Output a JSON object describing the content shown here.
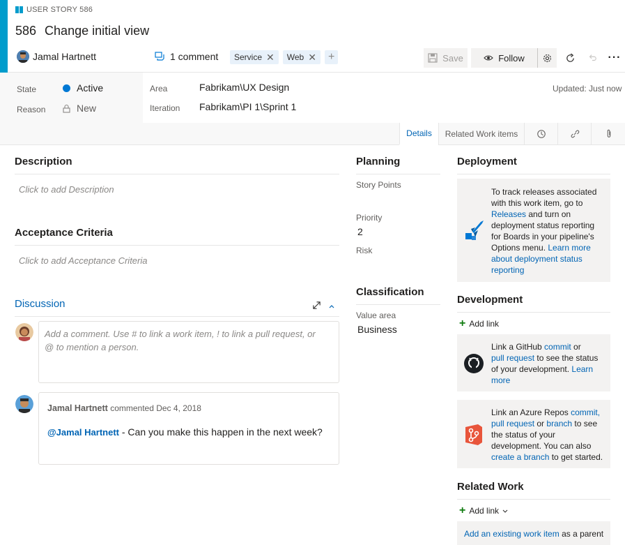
{
  "header": {
    "type_label": "USER STORY 586",
    "id": "586",
    "title": "Change initial view",
    "assignee": "Jamal Hartnett",
    "comments": "1 comment",
    "tags": [
      "Service",
      "Web"
    ],
    "save_label": "Save",
    "follow_label": "Follow",
    "accent_color": "#009ccc"
  },
  "fields": {
    "state_label": "State",
    "state_value": "Active",
    "state_color": "#0078d4",
    "reason_label": "Reason",
    "reason_value": "New",
    "area_label": "Area",
    "area_value": "Fabrikam\\UX Design",
    "iteration_label": "Iteration",
    "iteration_value": "Fabrikam\\PI 1\\Sprint 1",
    "updated": "Updated: Just now"
  },
  "tabs": {
    "details": "Details",
    "related": "Related Work items"
  },
  "description": {
    "title": "Description",
    "placeholder": "Click to add Description"
  },
  "acceptance": {
    "title": "Acceptance Criteria",
    "placeholder": "Click to add Acceptance Criteria"
  },
  "discussion": {
    "title": "Discussion",
    "comment_placeholder_1": "Add a comment. Use # to link a work item, ! to link a pull request, or",
    "comment_placeholder_2": "@ to mention a person.",
    "comment": {
      "author": "Jamal Hartnett",
      "meta": "commented Dec 4, 2018",
      "mention": "@Jamal Hartnett",
      "text": " - Can you make this happen in the next week?"
    }
  },
  "planning": {
    "title": "Planning",
    "story_points_label": "Story Points",
    "priority_label": "Priority",
    "priority_value": "2",
    "risk_label": "Risk"
  },
  "classification": {
    "title": "Classification",
    "value_area_label": "Value area",
    "value_area_value": "Business"
  },
  "deployment": {
    "title": "Deployment",
    "l1": "To track releases associated",
    "l2": "with this work item, go to",
    "l3_link": "Releases",
    "l3_rest": " and turn on",
    "l4": "deployment status reporting",
    "l5": "for Boards in your pipeline's",
    "l6_text": "Options menu. ",
    "l6_link": "Learn more",
    "l7_link": "about deployment status",
    "l8_link": "reporting"
  },
  "development": {
    "title": "Development",
    "add_link": "Add link",
    "gh_l1_text": "Link a GitHub ",
    "gh_l1_link": "commit",
    "gh_l1_rest": " or",
    "gh_l2_link": "pull request",
    "gh_l2_rest": " to see the status",
    "gh_l3_text": "of your development. ",
    "gh_l3_link": "Learn",
    "gh_l4_link": "more",
    "az_l1_text": "Link an Azure Repos ",
    "az_l1_link": "commit,",
    "az_l2_link1": "pull request",
    "az_l2_mid": " or ",
    "az_l2_link2": "branch",
    "az_l2_rest": " to see",
    "az_l3": "the status of your",
    "az_l4": "development. You can also",
    "az_l5_link": "create a branch",
    "az_l5_rest": " to get started."
  },
  "related_work": {
    "title": "Related Work",
    "add_link": "Add link",
    "parent_link": "Add an existing work item",
    "parent_rest": " as a parent"
  }
}
